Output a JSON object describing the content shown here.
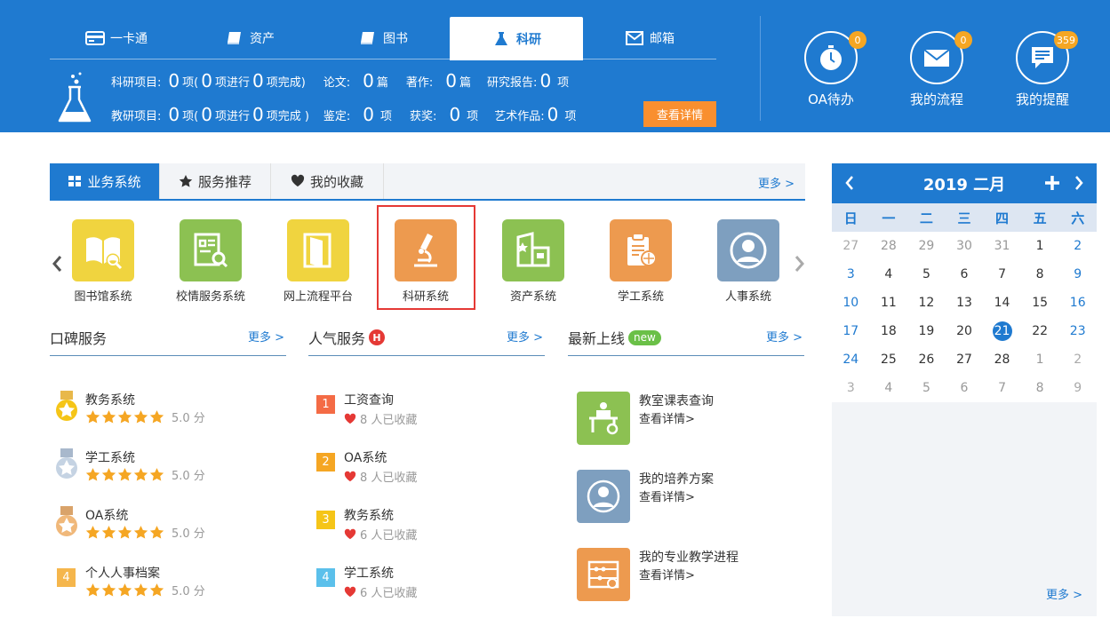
{
  "header": {
    "tabs": [
      {
        "label": "一卡通",
        "icon": "card-icon"
      },
      {
        "label": "资产",
        "icon": "book-icon"
      },
      {
        "label": "图书",
        "icon": "book-icon"
      },
      {
        "label": "科研",
        "icon": "flask-icon",
        "active": true
      },
      {
        "label": "邮箱",
        "icon": "mail-icon"
      }
    ],
    "row1": {
      "research_label": "科研项目:",
      "research_total": "0",
      "u_xiang": "项(",
      "research_ongoing": "0",
      "u_ongoing": "项进行",
      "research_done": "0",
      "u_done": "项完成)",
      "paper_label": "论文:",
      "paper_count": "0",
      "u_pian": "篇",
      "book_label": "著作:",
      "book_count": "0",
      "u_pian2": "篇",
      "report_label": "研究报告:",
      "report_count": "0",
      "u_xiang2": "项"
    },
    "row2": {
      "teach_label": "教研项目:",
      "teach_total": "0",
      "u_xiang": "项(",
      "teach_ongoing": "0",
      "u_ongoing": "项进行",
      "teach_done": "0",
      "u_done": "项完成 )",
      "appraisal_label": "鉴定:",
      "appraisal_count": "0",
      "u_xiang2": "项",
      "award_label": "获奖:",
      "award_count": "0",
      "u_xiang3": "项",
      "art_label": "艺术作品:",
      "art_count": "0",
      "u_xiang4": "项"
    },
    "detail_button": "查看详情",
    "quick": [
      {
        "label": "OA待办",
        "badge": "0"
      },
      {
        "label": "我的流程",
        "badge": "0"
      },
      {
        "label": "我的提醒",
        "badge": "359"
      }
    ],
    "colors": {
      "primary": "#1f7ad0",
      "badge": "#f5a623",
      "button": "#f98f2f"
    }
  },
  "panel": {
    "tabs": [
      "业务系统",
      "服务推荐",
      "我的收藏"
    ],
    "more": "更多 >",
    "systems": [
      {
        "name": "图书馆系统",
        "color": "#f0d43f"
      },
      {
        "name": "校情服务系统",
        "color": "#8cc152"
      },
      {
        "name": "网上流程平台",
        "color": "#f0d43f"
      },
      {
        "name": "科研系统",
        "color": "#ed9a4f",
        "selected": true
      },
      {
        "name": "资产系统",
        "color": "#8cc152"
      },
      {
        "name": "学工系统",
        "color": "#ed9a4f"
      },
      {
        "name": "人事系统",
        "color": "#7e9fbf"
      }
    ]
  },
  "columns": {
    "reputation": {
      "title": "口碑服务",
      "more": "更多 >",
      "items": [
        {
          "name": "教务系统",
          "score": "5.0 分",
          "medal": "gold"
        },
        {
          "name": "学工系统",
          "score": "5.0 分",
          "medal": "silver"
        },
        {
          "name": "OA系统",
          "score": "5.0 分",
          "medal": "bronze"
        },
        {
          "name": "个人人事档案",
          "score": "5.0 分",
          "rank": "4"
        }
      ]
    },
    "popular": {
      "title": "人气服务",
      "hot": "H",
      "more": "更多 >",
      "items": [
        {
          "rank": "1",
          "name": "工资查询",
          "fav": "8 人已收藏",
          "color": "#f46b45"
        },
        {
          "rank": "2",
          "name": "OA系统",
          "fav": "8 人已收藏",
          "color": "#f5a623"
        },
        {
          "rank": "3",
          "name": "教务系统",
          "fav": "6 人已收藏",
          "color": "#f5c518"
        },
        {
          "rank": "4",
          "name": "学工系统",
          "fav": "6 人已收藏",
          "color": "#5bc0eb"
        }
      ]
    },
    "latest": {
      "title": "最新上线",
      "tag": "new",
      "more": "更多 >",
      "items": [
        {
          "name": "教室课表查询",
          "detail": "查看详情>",
          "color": "#8cc152"
        },
        {
          "name": "我的培养方案",
          "detail": "查看详情>",
          "color": "#7e9fbf"
        },
        {
          "name": "我的专业教学进程",
          "detail": "查看详情>",
          "color": "#ed9a4f"
        }
      ]
    }
  },
  "calendar": {
    "title": "2019 二月",
    "weekdays": [
      "日",
      "一",
      "二",
      "三",
      "四",
      "五",
      "六"
    ],
    "days": [
      "27",
      "28",
      "29",
      "30",
      "31",
      "1",
      "2",
      "3",
      "4",
      "5",
      "6",
      "7",
      "8",
      "9",
      "10",
      "11",
      "12",
      "13",
      "14",
      "15",
      "16",
      "17",
      "18",
      "19",
      "20",
      "21",
      "22",
      "23",
      "24",
      "25",
      "26",
      "27",
      "28",
      "1",
      "2",
      "3",
      "4",
      "5",
      "6",
      "7",
      "8",
      "9"
    ],
    "today": "21",
    "more": "更多 >"
  }
}
